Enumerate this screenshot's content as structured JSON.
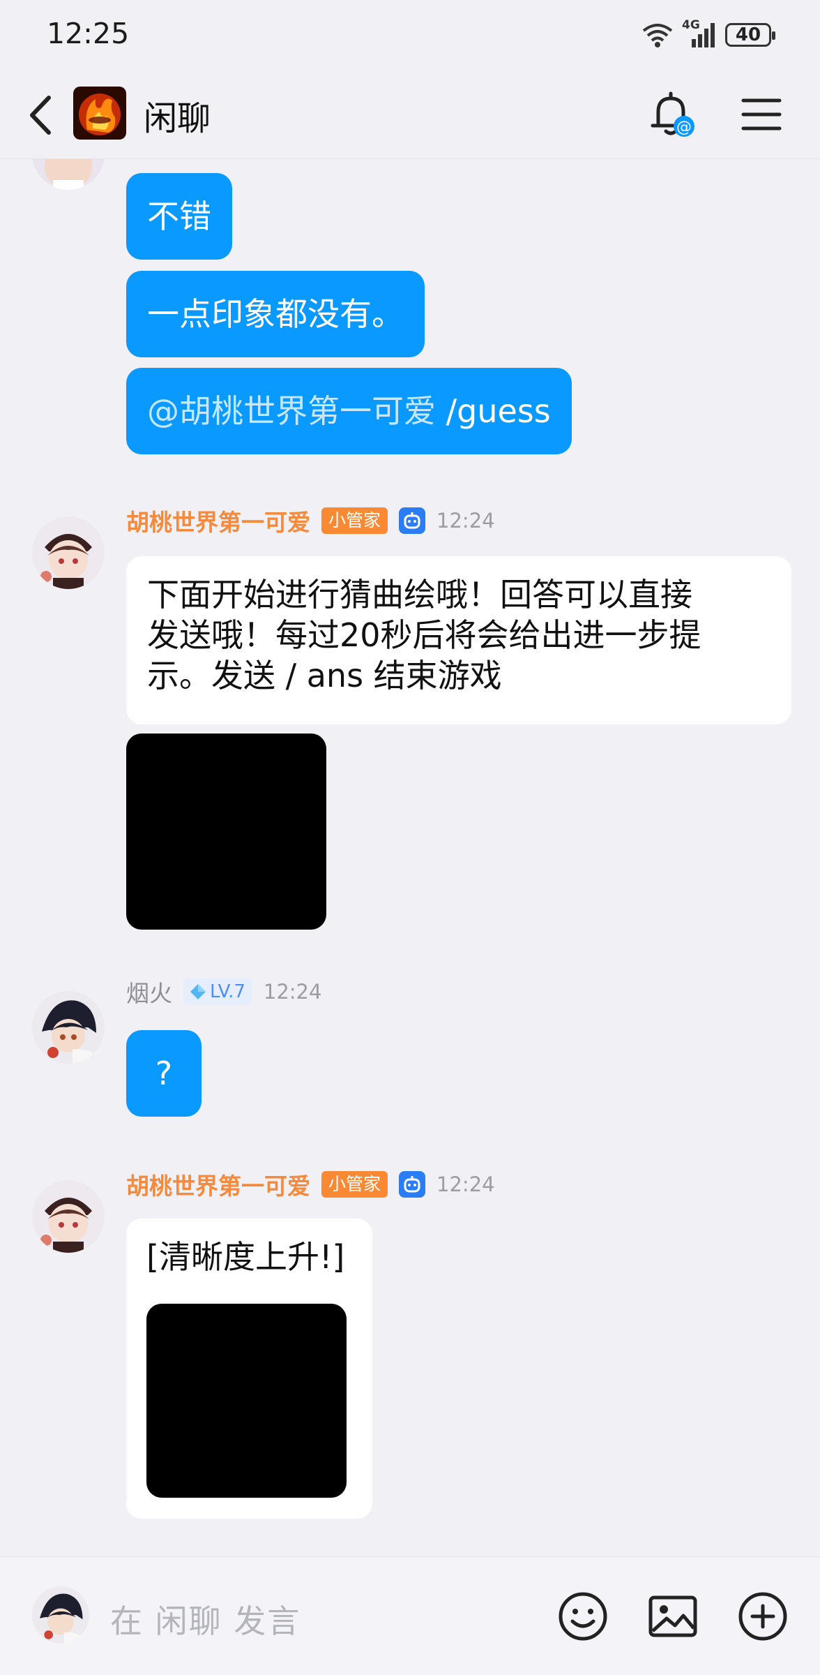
{
  "status_bar": {
    "time": "12:25",
    "network": "4G",
    "battery": "40"
  },
  "header": {
    "title": "闲聊",
    "group_icon": "flame-logo-icon",
    "bell_icon": "bell-at-icon",
    "menu_icon": "hamburger-menu-icon"
  },
  "messages": [
    {
      "bubbles": [
        "不错",
        "一点印象都没有。"
      ],
      "mention_bubble": {
        "mention": "@胡桃世界第一可爱",
        "command": " /guess"
      }
    },
    {
      "sender": "胡桃世界第一可爱",
      "badge": "小管家",
      "time": "12:24",
      "text": "下面开始进行猜曲绘哦！回答可以直接发送哦！每过20秒后将会给出进一步提示。发送 / ans 结束游戏",
      "lines": [
        "下面开始进行猜曲绘哦！回答可以直接",
        "发送哦！每过20秒后将会给出进一步提",
        "示。发送 / ans 结束游戏"
      ]
    },
    {
      "sender": "烟火",
      "level": "LV.7",
      "time": "12:24",
      "text": "?"
    },
    {
      "sender": "胡桃世界第一可爱",
      "badge": "小管家",
      "time": "12:24",
      "text": "[清晰度上升!]"
    }
  ],
  "input": {
    "placeholder": "在 闲聊 发言"
  },
  "colors": {
    "accent_blue": "#0a99ff",
    "admin_orange": "#f98a33",
    "background": "#f1f1f5"
  }
}
